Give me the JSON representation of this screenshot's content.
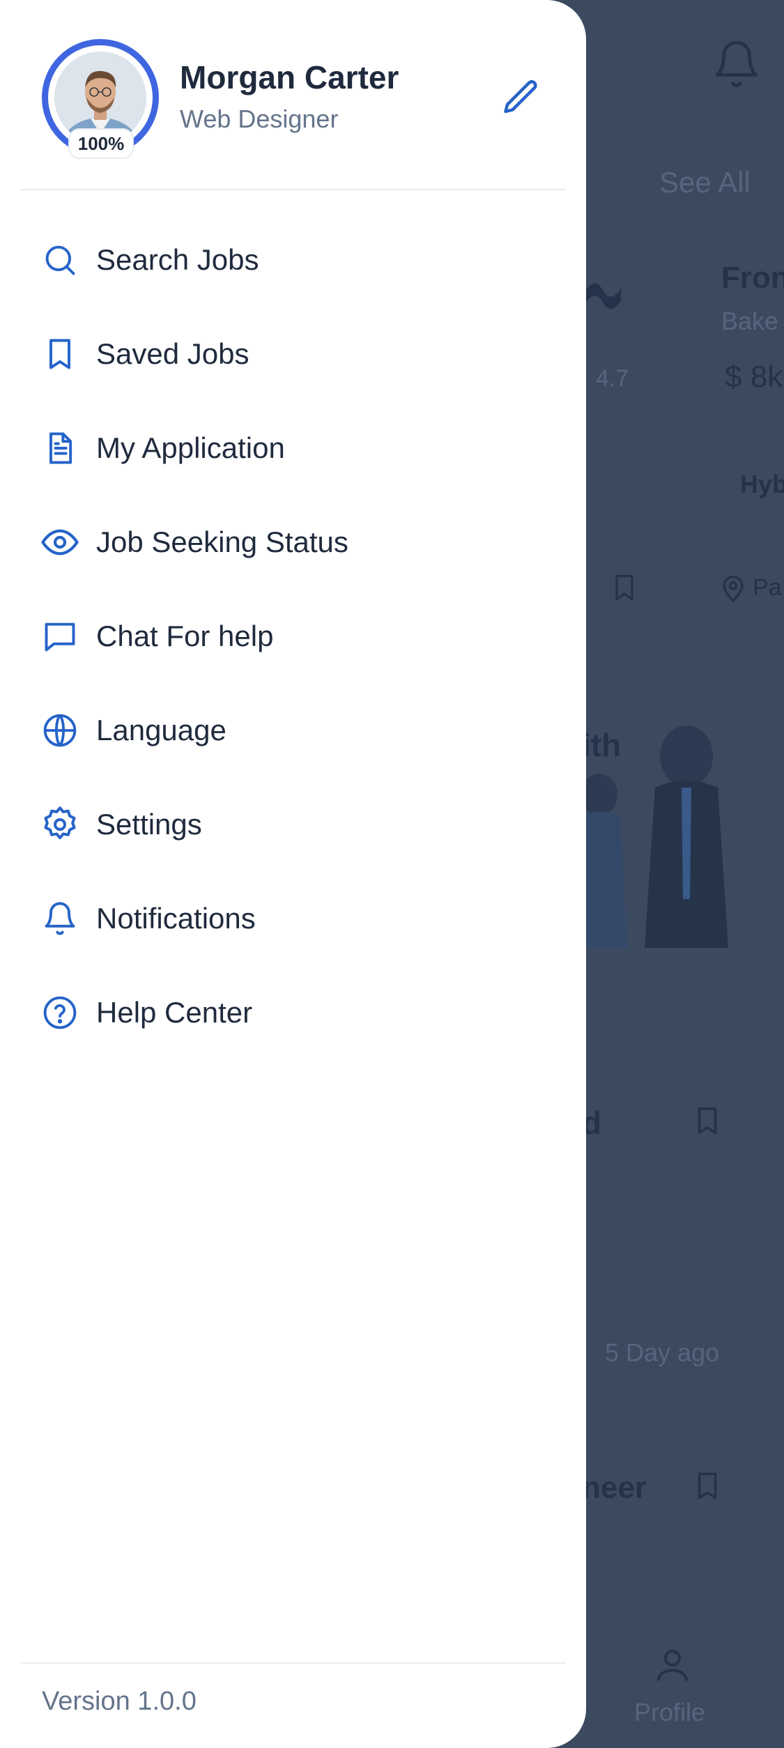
{
  "drawer": {
    "profile": {
      "name": "Morgan Carter",
      "role": "Web Designer",
      "completion": "100%"
    },
    "menu": [
      {
        "label": "Search Jobs",
        "icon": "search-icon"
      },
      {
        "label": "Saved Jobs",
        "icon": "bookmark-icon"
      },
      {
        "label": "My Application",
        "icon": "document-icon"
      },
      {
        "label": "Job Seeking Status",
        "icon": "eye-icon"
      },
      {
        "label": "Chat For help",
        "icon": "chat-icon"
      },
      {
        "label": "Language",
        "icon": "globe-icon"
      },
      {
        "label": "Settings",
        "icon": "gear-icon"
      },
      {
        "label": "Notifications",
        "icon": "bell-icon"
      },
      {
        "label": "Help Center",
        "icon": "help-circle-icon"
      }
    ],
    "version": "Version 1.0.0"
  },
  "background": {
    "see_all": "See All",
    "job_title_fragment": "Fron",
    "company_fragment": "Bake",
    "rating": "4.7",
    "salary_fragment": "$ 8k",
    "work_type_fragment": "Hyb",
    "location_fragment": "Pa",
    "banner_fragment": "ith",
    "job2_fragment": "d",
    "posted": "5 Day ago",
    "job3_fragment": "neer",
    "nav_profile": "Profile"
  },
  "colors": {
    "accent": "#2563c9",
    "ring": "#3f66e0",
    "text": "#1f2a3d",
    "muted": "#64748b",
    "overlay": "#3c4a60"
  }
}
